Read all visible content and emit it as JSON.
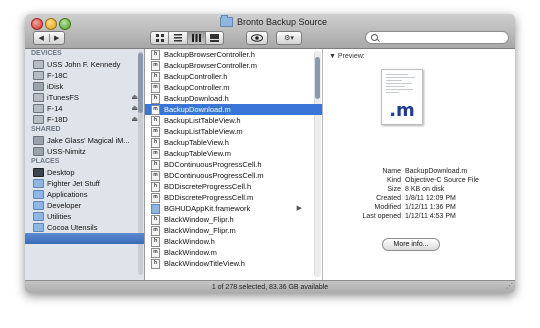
{
  "window": {
    "title": "Bronto Backup Source"
  },
  "toolbar": {
    "back_icon": "back-arrow-icon",
    "back_glyph": "◀",
    "forward_glyph": "▶",
    "eye_glyph": "👁",
    "action_glyph": "⚙▾"
  },
  "sidebar": {
    "sections": [
      {
        "title": "DEVICES",
        "items": [
          {
            "label": "USS John F. Kennedy",
            "icon": "hard-drive-icon"
          },
          {
            "label": "F-18C",
            "icon": "hard-drive-icon"
          },
          {
            "label": "iDisk",
            "icon": "idisk-icon"
          },
          {
            "label": "iTunesFS",
            "icon": "disk-icon",
            "eject": "⏏"
          },
          {
            "label": "F-14",
            "icon": "disk-icon",
            "eject": "⏏"
          },
          {
            "label": "F-18D",
            "icon": "disk-icon",
            "eject": "⏏"
          }
        ]
      },
      {
        "title": "SHARED",
        "items": [
          {
            "label": "Jake Glass' Magical iM...",
            "icon": "computer-icon"
          },
          {
            "label": "USS-Nimitz",
            "icon": "computer-icon"
          }
        ]
      },
      {
        "title": "PLACES",
        "items": [
          {
            "label": "Desktop",
            "icon": "desktop-icon"
          },
          {
            "label": "Fighter Jet Stuff",
            "icon": "folder-icon"
          },
          {
            "label": "Applications",
            "icon": "folder-icon"
          },
          {
            "label": "Developer",
            "icon": "folder-icon"
          },
          {
            "label": "Utilities",
            "icon": "folder-icon"
          },
          {
            "label": "Cocoa Utensils",
            "icon": "folder-icon"
          }
        ]
      }
    ]
  },
  "files": [
    {
      "name": "BackupBrowserController.h",
      "type": "h"
    },
    {
      "name": "BackupBrowserController.m",
      "type": "m"
    },
    {
      "name": "BackupController.h",
      "type": "h"
    },
    {
      "name": "BackupController.m",
      "type": "m"
    },
    {
      "name": "BackupDownload.h",
      "type": "h"
    },
    {
      "name": "BackupDownload.m",
      "type": "m",
      "selected": true
    },
    {
      "name": "BackupListTableView.h",
      "type": "h"
    },
    {
      "name": "BackupListTableView.m",
      "type": "m"
    },
    {
      "name": "BackupTableView.h",
      "type": "h"
    },
    {
      "name": "BackupTableView.m",
      "type": "m"
    },
    {
      "name": "BDContinuousProgressCell.h",
      "type": "h"
    },
    {
      "name": "BDContinuousProgressCell.m",
      "type": "m"
    },
    {
      "name": "BDDiscreteProgressCell.h",
      "type": "h"
    },
    {
      "name": "BDDiscreteProgressCell.m",
      "type": "m"
    },
    {
      "name": "BGHUDAppKit.framework",
      "type": "dir",
      "arrow": "▶"
    },
    {
      "name": "BlackWindow_Flipr.h",
      "type": "h"
    },
    {
      "name": "BlackWindow_Flipr.m",
      "type": "m"
    },
    {
      "name": "BlackWindow.h",
      "type": "h"
    },
    {
      "name": "BlackWindow.m",
      "type": "m"
    },
    {
      "name": "BlackWindowTitleView.h",
      "type": "h"
    }
  ],
  "preview": {
    "header": "Preview:",
    "toggle_glyph": "▼",
    "doc_ext": ".m",
    "meta": [
      {
        "key": "Name",
        "value": "BackupDownload.m"
      },
      {
        "key": "Kind",
        "value": "Objective-C Source File"
      },
      {
        "key": "Size",
        "value": "8 KB on disk"
      },
      {
        "key": "Created",
        "value": "1/8/11 12:09 PM"
      },
      {
        "key": "Modified",
        "value": "1/12/11 1:36 PM"
      },
      {
        "key": "Last opened",
        "value": "1/12/11 4:53 PM"
      }
    ],
    "more_info": "More info..."
  },
  "status": {
    "text": "1 of 278 selected, 83.36 GB available"
  }
}
